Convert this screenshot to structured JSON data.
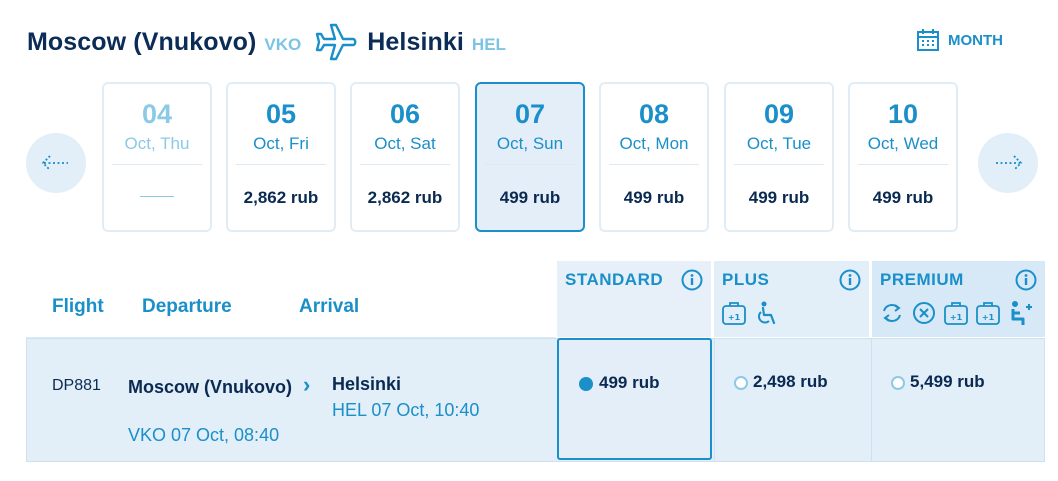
{
  "route": {
    "from_city": "Moscow (Vnukovo)",
    "from_code": "VKO",
    "to_city": "Helsinki",
    "to_code": "HEL",
    "month_label": "MONTH"
  },
  "dates": [
    {
      "day": "04",
      "dow": "Oct, Thu",
      "price": "",
      "state": "past"
    },
    {
      "day": "05",
      "dow": "Oct, Fri",
      "price": "2,862 rub",
      "state": "normal"
    },
    {
      "day": "06",
      "dow": "Oct, Sat",
      "price": "2,862 rub",
      "state": "normal"
    },
    {
      "day": "07",
      "dow": "Oct, Sun",
      "price": "499 rub",
      "state": "selected"
    },
    {
      "day": "08",
      "dow": "Oct, Mon",
      "price": "499 rub",
      "state": "normal"
    },
    {
      "day": "09",
      "dow": "Oct, Tue",
      "price": "499 rub",
      "state": "normal"
    },
    {
      "day": "10",
      "dow": "Oct, Wed",
      "price": "499 rub",
      "state": "normal"
    }
  ],
  "table": {
    "col_flight": "Flight",
    "col_departure": "Departure",
    "col_arrival": "Arrival",
    "tiers": {
      "standard": "STANDARD",
      "plus": "PLUS",
      "premium": "PREMIUM"
    }
  },
  "flight": {
    "number": "DP881",
    "dep_city": "Moscow (Vnukovo)",
    "dep_detail": "VKO 07 Oct, 08:40",
    "arr_city": "Helsinki",
    "arr_detail": "HEL 07 Oct, 10:40",
    "fares": {
      "standard": "499 rub",
      "plus": "2,498 rub",
      "premium": "5,499 rub"
    },
    "selected_fare": "standard"
  },
  "colors": {
    "accent": "#1a8fc9",
    "text_dark": "#0a2a52",
    "panel": "#e2eef8"
  }
}
